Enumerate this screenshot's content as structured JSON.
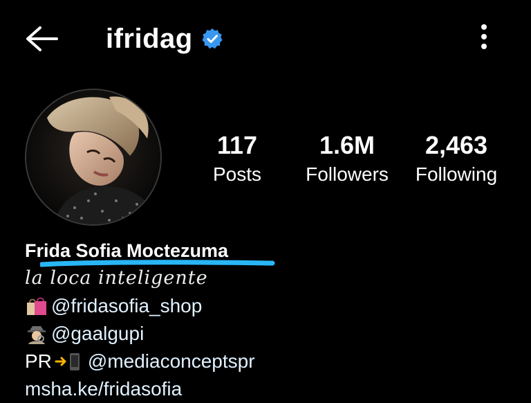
{
  "header": {
    "username": "ifridag",
    "verified": true,
    "back_icon": "arrow-left-icon",
    "more_icon": "vertical-dots-icon",
    "verified_color": "#3897f0"
  },
  "profile": {
    "avatar_icon": "profile-photo",
    "stats": {
      "posts_count": "117",
      "posts_label": "Posts",
      "followers_count": "1.6M",
      "followers_label": "Followers",
      "following_count": "2,463",
      "following_label": "Following"
    },
    "bio": {
      "full_name": "Frida Sofia Moctezuma",
      "tagline": "la loca inteligente",
      "line1_icon": "shopping-bags-icon",
      "line1_text": "@fridasofia_shop",
      "line2_icon": "detective-icon",
      "line2_text": "@gaalgupi",
      "line3_prefix": "PR",
      "line3_icon": "arrow-phone-icon",
      "line3_text": "@mediaconceptspr",
      "website": "msha.ke/fridasofia"
    }
  },
  "colors": {
    "background": "#000000",
    "text": "#ffffff",
    "highlight_underline": "#29b6f6"
  }
}
